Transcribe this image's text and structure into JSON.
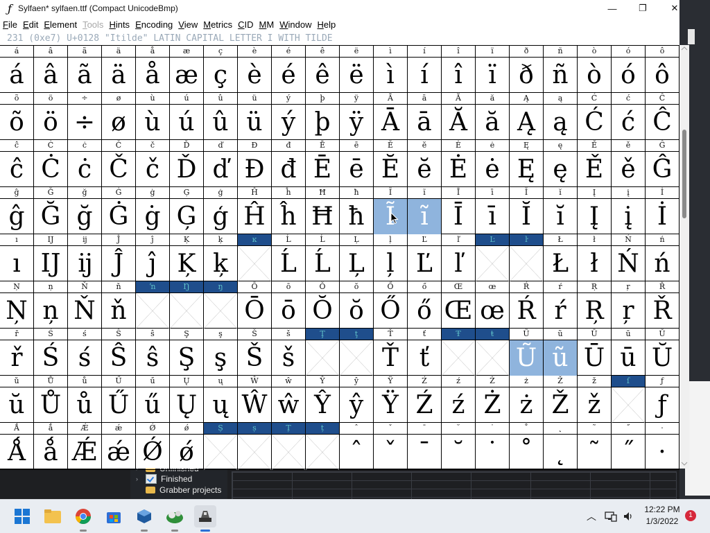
{
  "window": {
    "title": "Sylfaen*  sylfaen.ttf (Compact UnicodeBmp)",
    "minimize": "—",
    "maximize": "❐",
    "close": "✕"
  },
  "menu": [
    {
      "label": "File",
      "ul": "F",
      "rest": "ile",
      "disabled": false
    },
    {
      "label": "Edit",
      "ul": "E",
      "rest": "dit",
      "disabled": false
    },
    {
      "label": "Element",
      "ul": "E",
      "rest": "lement",
      "disabled": false
    },
    {
      "label": "Tools",
      "ul": "T",
      "rest": "ools",
      "disabled": true
    },
    {
      "label": "Hints",
      "ul": "H",
      "rest": "ints",
      "disabled": false
    },
    {
      "label": "Encoding",
      "ul": "E",
      "rest": "ncoding",
      "disabled": false
    },
    {
      "label": "View",
      "ul": "V",
      "rest": "iew",
      "disabled": false
    },
    {
      "label": "Metrics",
      "ul": "M",
      "rest": "etrics",
      "disabled": false
    },
    {
      "label": "CID",
      "ul": "C",
      "rest": "ID",
      "disabled": false
    },
    {
      "label": "MM",
      "ul": "M",
      "rest": "M",
      "disabled": false
    },
    {
      "label": "Window",
      "ul": "W",
      "rest": "indow",
      "disabled": false
    },
    {
      "label": "Help",
      "ul": "H",
      "rest": "elp",
      "disabled": false
    }
  ],
  "info_line": "231 (0xe7) U+0128 \"Itilde\" LATIN CAPITAL LETTER I WITH TILDE",
  "rows": [
    [
      {
        "l": "á",
        "g": "á"
      },
      {
        "l": "â",
        "g": "â"
      },
      {
        "l": "ã",
        "g": "ã"
      },
      {
        "l": "ä",
        "g": "ä"
      },
      {
        "l": "å",
        "g": "å"
      },
      {
        "l": "æ",
        "g": "æ"
      },
      {
        "l": "ç",
        "g": "ç"
      },
      {
        "l": "è",
        "g": "è"
      },
      {
        "l": "é",
        "g": "é"
      },
      {
        "l": "ê",
        "g": "ê"
      },
      {
        "l": "ë",
        "g": "ë"
      },
      {
        "l": "ì",
        "g": "ì"
      },
      {
        "l": "í",
        "g": "í"
      },
      {
        "l": "î",
        "g": "î"
      },
      {
        "l": "ï",
        "g": "ï"
      },
      {
        "l": "ð",
        "g": "ð"
      },
      {
        "l": "ñ",
        "g": "ñ"
      },
      {
        "l": "ò",
        "g": "ò"
      },
      {
        "l": "ó",
        "g": "ó"
      },
      {
        "l": "ô",
        "g": "ô"
      }
    ],
    [
      {
        "l": "õ",
        "g": "õ"
      },
      {
        "l": "ö",
        "g": "ö"
      },
      {
        "l": "÷",
        "g": "÷"
      },
      {
        "l": "ø",
        "g": "ø"
      },
      {
        "l": "ù",
        "g": "ù"
      },
      {
        "l": "ú",
        "g": "ú"
      },
      {
        "l": "û",
        "g": "û"
      },
      {
        "l": "ü",
        "g": "ü"
      },
      {
        "l": "ý",
        "g": "ý"
      },
      {
        "l": "þ",
        "g": "þ"
      },
      {
        "l": "ÿ",
        "g": "ÿ"
      },
      {
        "l": "Ā",
        "g": "Ā"
      },
      {
        "l": "ā",
        "g": "ā"
      },
      {
        "l": "Ă",
        "g": "Ă"
      },
      {
        "l": "ă",
        "g": "ă"
      },
      {
        "l": "Ą",
        "g": "Ą"
      },
      {
        "l": "ą",
        "g": "ą"
      },
      {
        "l": "Ć",
        "g": "Ć"
      },
      {
        "l": "ć",
        "g": "ć"
      },
      {
        "l": "Ĉ",
        "g": "Ĉ"
      }
    ],
    [
      {
        "l": "ĉ",
        "g": "ĉ"
      },
      {
        "l": "Ċ",
        "g": "Ċ"
      },
      {
        "l": "ċ",
        "g": "ċ"
      },
      {
        "l": "Č",
        "g": "Č"
      },
      {
        "l": "č",
        "g": "č"
      },
      {
        "l": "Ď",
        "g": "Ď"
      },
      {
        "l": "ď",
        "g": "ď"
      },
      {
        "l": "Đ",
        "g": "Đ"
      },
      {
        "l": "đ",
        "g": "đ"
      },
      {
        "l": "Ē",
        "g": "Ē"
      },
      {
        "l": "ē",
        "g": "ē"
      },
      {
        "l": "Ĕ",
        "g": "Ĕ"
      },
      {
        "l": "ĕ",
        "g": "ĕ"
      },
      {
        "l": "Ė",
        "g": "Ė"
      },
      {
        "l": "ė",
        "g": "ė"
      },
      {
        "l": "Ę",
        "g": "Ę"
      },
      {
        "l": "ę",
        "g": "ę"
      },
      {
        "l": "Ě",
        "g": "Ě"
      },
      {
        "l": "ě",
        "g": "ě"
      },
      {
        "l": "Ĝ",
        "g": "Ĝ"
      }
    ],
    [
      {
        "l": "ĝ",
        "g": "ĝ"
      },
      {
        "l": "Ğ",
        "g": "Ğ"
      },
      {
        "l": "ğ",
        "g": "ğ"
      },
      {
        "l": "Ġ",
        "g": "Ġ"
      },
      {
        "l": "ġ",
        "g": "ġ"
      },
      {
        "l": "Ģ",
        "g": "Ģ"
      },
      {
        "l": "ģ",
        "g": "ģ"
      },
      {
        "l": "Ĥ",
        "g": "Ĥ"
      },
      {
        "l": "ĥ",
        "g": "ĥ"
      },
      {
        "l": "Ħ",
        "g": "Ħ"
      },
      {
        "l": "ħ",
        "g": "ħ"
      },
      {
        "l": "Ĩ",
        "g": "Ĩ",
        "sel": true
      },
      {
        "l": "ĩ",
        "g": "ĩ",
        "sel": true
      },
      {
        "l": "Ī",
        "g": "Ī"
      },
      {
        "l": "ī",
        "g": "ī"
      },
      {
        "l": "Ĭ",
        "g": "Ĭ"
      },
      {
        "l": "ĭ",
        "g": "ĭ"
      },
      {
        "l": "Į",
        "g": "Į"
      },
      {
        "l": "į",
        "g": "į"
      },
      {
        "l": "İ",
        "g": "İ"
      }
    ],
    [
      {
        "l": "ı",
        "g": "ı"
      },
      {
        "l": "Ĳ",
        "g": "Ĳ"
      },
      {
        "l": "ĳ",
        "g": "ĳ"
      },
      {
        "l": "Ĵ",
        "g": "Ĵ"
      },
      {
        "l": "ĵ",
        "g": "ĵ"
      },
      {
        "l": "Ķ",
        "g": "Ķ"
      },
      {
        "l": "ķ",
        "g": "ķ"
      },
      {
        "l": "ĸ",
        "g": "",
        "hl": true
      },
      {
        "l": "Ĺ",
        "g": "Ĺ"
      },
      {
        "l": "Ĺ",
        "g": "Ĺ"
      },
      {
        "l": "Ļ",
        "g": "Ļ"
      },
      {
        "l": "ļ",
        "g": "ļ"
      },
      {
        "l": "Ľ",
        "g": "Ľ"
      },
      {
        "l": "ľ",
        "g": "ľ"
      },
      {
        "l": "Ŀ",
        "g": "",
        "hl": true
      },
      {
        "l": "ŀ",
        "g": "",
        "hl": true
      },
      {
        "l": "Ł",
        "g": "Ł"
      },
      {
        "l": "ł",
        "g": "ł"
      },
      {
        "l": "Ń",
        "g": "Ń"
      },
      {
        "l": "ń",
        "g": "ń"
      }
    ],
    [
      {
        "l": "Ņ",
        "g": "Ņ"
      },
      {
        "l": "ņ",
        "g": "ņ"
      },
      {
        "l": "Ň",
        "g": "Ň"
      },
      {
        "l": "ň",
        "g": "ň"
      },
      {
        "l": "ŉ",
        "g": "",
        "hl": true
      },
      {
        "l": "Ŋ",
        "g": "",
        "hl": true
      },
      {
        "l": "ŋ",
        "g": "",
        "hl": true
      },
      {
        "l": "Ō",
        "g": "Ō"
      },
      {
        "l": "ō",
        "g": "ō"
      },
      {
        "l": "Ŏ",
        "g": "Ŏ"
      },
      {
        "l": "ŏ",
        "g": "ŏ"
      },
      {
        "l": "Ő",
        "g": "Ő"
      },
      {
        "l": "ő",
        "g": "ő"
      },
      {
        "l": "Œ",
        "g": "Œ"
      },
      {
        "l": "œ",
        "g": "œ"
      },
      {
        "l": "Ŕ",
        "g": "Ŕ"
      },
      {
        "l": "ŕ",
        "g": "ŕ"
      },
      {
        "l": "Ŗ",
        "g": "Ŗ"
      },
      {
        "l": "ŗ",
        "g": "ŗ"
      },
      {
        "l": "Ř",
        "g": "Ř"
      }
    ],
    [
      {
        "l": "ř",
        "g": "ř"
      },
      {
        "l": "Ś",
        "g": "Ś"
      },
      {
        "l": "ś",
        "g": "ś"
      },
      {
        "l": "Ŝ",
        "g": "Ŝ"
      },
      {
        "l": "ŝ",
        "g": "ŝ"
      },
      {
        "l": "Ş",
        "g": "Ş"
      },
      {
        "l": "ş",
        "g": "ş"
      },
      {
        "l": "Š",
        "g": "Š"
      },
      {
        "l": "š",
        "g": "š"
      },
      {
        "l": "Ţ",
        "g": "",
        "hl": true
      },
      {
        "l": "ţ",
        "g": "",
        "hl": true
      },
      {
        "l": "Ť",
        "g": "Ť"
      },
      {
        "l": "ť",
        "g": "ť"
      },
      {
        "l": "Ŧ",
        "g": "",
        "hl": true
      },
      {
        "l": "ŧ",
        "g": "",
        "hl": true
      },
      {
        "l": "Ũ",
        "g": "Ũ",
        "sel": true
      },
      {
        "l": "ũ",
        "g": "ũ",
        "sel": true
      },
      {
        "l": "Ū",
        "g": "Ū"
      },
      {
        "l": "ū",
        "g": "ū"
      },
      {
        "l": "Ŭ",
        "g": "Ŭ"
      }
    ],
    [
      {
        "l": "ŭ",
        "g": "ŭ"
      },
      {
        "l": "Ů",
        "g": "Ů"
      },
      {
        "l": "ů",
        "g": "ů"
      },
      {
        "l": "Ű",
        "g": "Ű"
      },
      {
        "l": "ű",
        "g": "ű"
      },
      {
        "l": "Ų",
        "g": "Ų"
      },
      {
        "l": "ų",
        "g": "ų"
      },
      {
        "l": "Ŵ",
        "g": "Ŵ"
      },
      {
        "l": "ŵ",
        "g": "ŵ"
      },
      {
        "l": "Ŷ",
        "g": "Ŷ"
      },
      {
        "l": "ŷ",
        "g": "ŷ"
      },
      {
        "l": "Ÿ",
        "g": "Ÿ"
      },
      {
        "l": "Ź",
        "g": "Ź"
      },
      {
        "l": "ź",
        "g": "ź"
      },
      {
        "l": "Ż",
        "g": "Ż"
      },
      {
        "l": "ż",
        "g": "ż"
      },
      {
        "l": "Ž",
        "g": "Ž"
      },
      {
        "l": "ž",
        "g": "ž"
      },
      {
        "l": "ſ",
        "g": "",
        "hl": true
      },
      {
        "l": "ƒ",
        "g": "ƒ"
      }
    ],
    [
      {
        "l": "Ǻ",
        "g": "Ǻ"
      },
      {
        "l": "ǻ",
        "g": "ǻ"
      },
      {
        "l": "Ǽ",
        "g": "Ǽ"
      },
      {
        "l": "ǽ",
        "g": "ǽ"
      },
      {
        "l": "Ǿ",
        "g": "Ǿ"
      },
      {
        "l": "ǿ",
        "g": "ǿ"
      },
      {
        "l": "Ș",
        "g": "",
        "hl": true
      },
      {
        "l": "ș",
        "g": "",
        "hl": true
      },
      {
        "l": "Ț",
        "g": "",
        "hl": true
      },
      {
        "l": "ț",
        "g": "",
        "hl": true
      },
      {
        "l": "ˆ",
        "g": "ˆ"
      },
      {
        "l": "ˇ",
        "g": "ˇ"
      },
      {
        "l": "ˉ",
        "g": "ˉ"
      },
      {
        "l": "˘",
        "g": "˘"
      },
      {
        "l": "˙",
        "g": "˙"
      },
      {
        "l": "˚",
        "g": "˚"
      },
      {
        "l": "˛",
        "g": "˛"
      },
      {
        "l": "˜",
        "g": "˜"
      },
      {
        "l": "˝",
        "g": "˝"
      },
      {
        "l": "·",
        "g": "·"
      }
    ]
  ],
  "tree": [
    {
      "label": "Unfinished",
      "icon": "folder-icon"
    },
    {
      "label": "Finished",
      "icon": "check-icon"
    },
    {
      "label": "Grabber projects",
      "icon": "folder-icon"
    }
  ],
  "taskbar": {
    "icons": [
      "windows-start-icon",
      "file-explorer-icon",
      "chrome-icon",
      "store-icon",
      "virtualbox-icon",
      "network-app-icon",
      "fontforge-icon"
    ],
    "time": "12:22 PM",
    "date": "1/3/2022",
    "notifications": "1"
  }
}
